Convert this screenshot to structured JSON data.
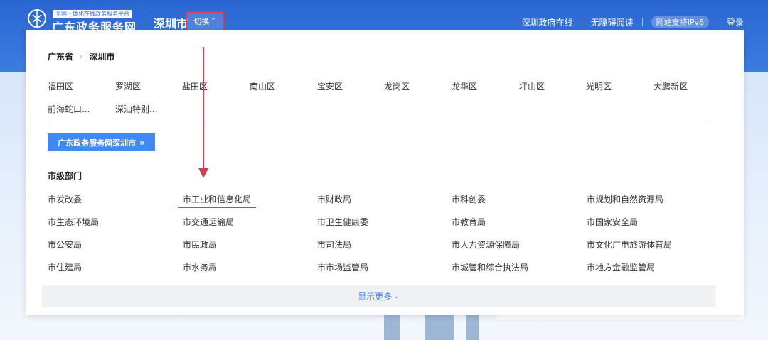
{
  "header": {
    "platform_tag": "全国一体化在线政务服务平台",
    "brand": "广东政务服务网",
    "city": "深圳市",
    "switch_label": "切换",
    "nav": [
      "深圳政府在线",
      "无障碍阅读",
      "网站支持IPv6",
      "登录"
    ]
  },
  "panel": {
    "breadcrumb": [
      "广东省",
      "深圳市"
    ],
    "districts": [
      "福田区",
      "罗湖区",
      "盐田区",
      "南山区",
      "宝安区",
      "龙岗区",
      "龙华区",
      "坪山区",
      "光明区",
      "大鹏新区",
      "前海蛇口...",
      "深汕特别..."
    ],
    "portal_button": "广东政务服务网深圳市",
    "section_title": "市级部门",
    "departments": [
      [
        "市发改委",
        "市工业和信息化局",
        "市财政局",
        "市科创委",
        "市规划和自然资源局"
      ],
      [
        "市生态环境局",
        "市交通运输局",
        "市卫生健康委",
        "市教育局",
        "市国家安全局"
      ],
      [
        "市公安局",
        "市民政局",
        "市司法局",
        "市人力资源保障局",
        "市文化广电旅游体育局"
      ],
      [
        "市住建局",
        "市水务局",
        "市市场监管局",
        "市城管和综合执法局",
        "市地方金融监管局"
      ]
    ],
    "more_label": "显示更多"
  },
  "colors": {
    "accent": "#3d8af7",
    "highlight": "#e03b4a",
    "header_bg": "#2a66d3"
  }
}
